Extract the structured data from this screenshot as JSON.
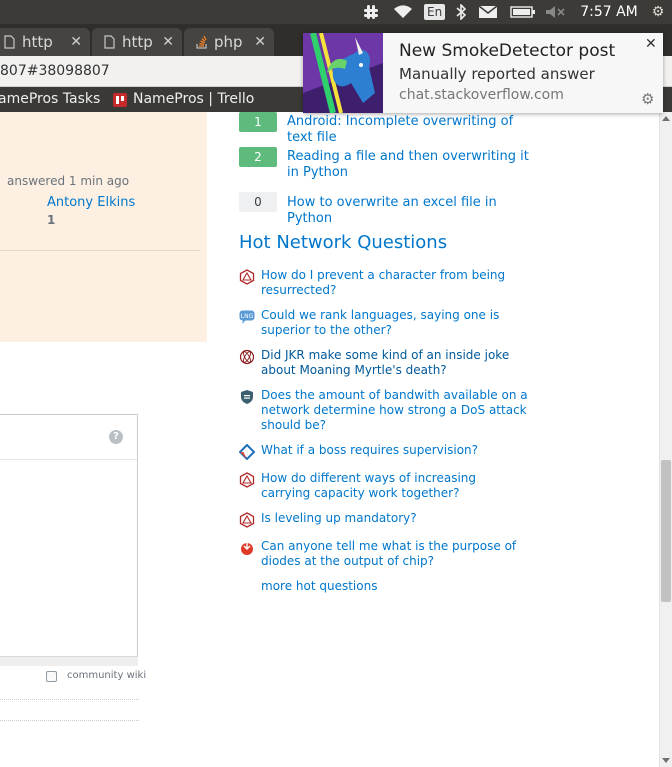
{
  "system_bar": {
    "keyboard_layout": "En",
    "time": "7:57 AM",
    "icons": [
      "slack-icon",
      "wifi-icon",
      "bluetooth-icon",
      "mail-icon",
      "battery-icon",
      "volume-muted-icon",
      "power-gear-icon"
    ]
  },
  "browser": {
    "tabs": [
      {
        "label": "http",
        "icon": "page-icon"
      },
      {
        "label": "http",
        "icon": "page-icon"
      },
      {
        "label": "php",
        "icon": "stackoverflow-icon"
      }
    ],
    "url": "807#38098807",
    "bookmarks": [
      {
        "label": "amePros Tasks"
      },
      {
        "label": "NamePros | Trello",
        "icon": "trello-icon"
      }
    ]
  },
  "notification": {
    "title": "New SmokeDetector post",
    "body": "Manually reported answer",
    "source": "chat.stackoverflow.com",
    "close": "✕",
    "settings": "⚙"
  },
  "answer": {
    "answered_time": "answered 1 min ago",
    "user_name": "Antony Elkins",
    "user_reputation": "1"
  },
  "editor": {
    "help": "?",
    "community_wiki_label": "community wiki"
  },
  "related_questions": [
    {
      "score": "1",
      "title": "Android: Incomplete overwriting of text file",
      "answered": true
    },
    {
      "score": "2",
      "title": "Reading a file and then overwriting it in Python",
      "answered": true
    },
    {
      "score": "0",
      "title": "How to overwrite an excel file in Python",
      "answered": false
    }
  ],
  "hot_network": {
    "heading": "Hot Network Questions",
    "questions": [
      {
        "title": "How do I prevent a character from being resurrected?",
        "site_icon": "rpg-d20-icon",
        "visited": false
      },
      {
        "title": "Could we rank languages, saying one is superior to the other?",
        "site_icon": "linguistics-lng-icon",
        "visited": false
      },
      {
        "title": "Did JKR make some kind of an inside joke about Moaning Myrtle's death?",
        "site_icon": "scifi-atom-icon",
        "visited": true
      },
      {
        "title": "Does the amount of bandwith available on a network determine how strong a DoS attack should be?",
        "site_icon": "security-shield-icon",
        "visited": false
      },
      {
        "title": "What if a boss requires supervision?",
        "site_icon": "workplace-diamond-icon",
        "visited": false
      },
      {
        "title": "How do different ways of increasing carrying capacity work together?",
        "site_icon": "rpg-d20-icon",
        "visited": false
      },
      {
        "title": "Is leveling up mandatory?",
        "site_icon": "rpg-d20-icon",
        "visited": false
      },
      {
        "title": "Can anyone tell me what is the purpose of diodes at the output of chip?",
        "site_icon": "electronics-icon",
        "visited": false
      }
    ],
    "more_label": "more hot questions"
  },
  "colors": {
    "link": "#0077cc",
    "visited_link": "#005999",
    "answer_bg": "#fdf0e2",
    "score_green": "#5fba7d",
    "score_grey": "#eff0f1",
    "topbar": "#3c3b37"
  }
}
